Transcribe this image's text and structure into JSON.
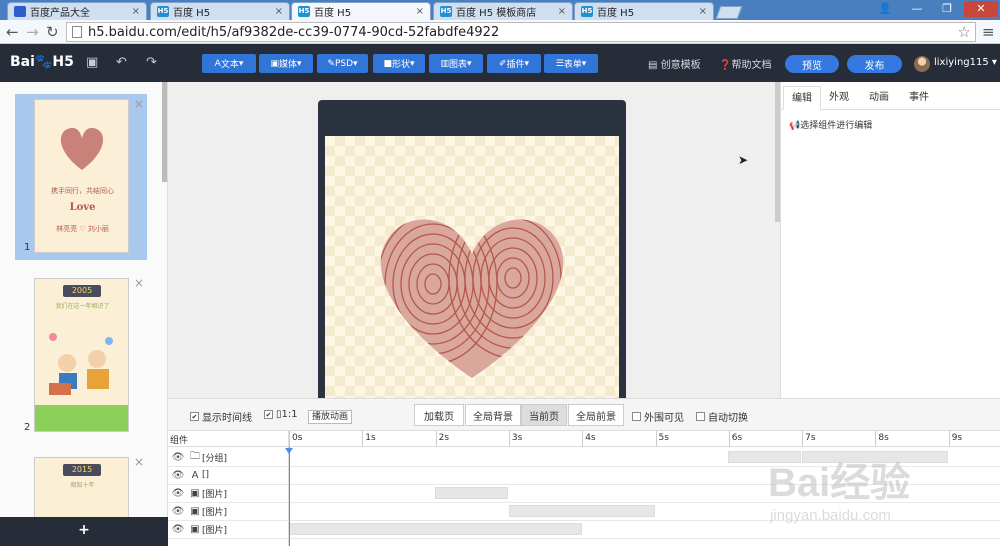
{
  "tabs": [
    {
      "title": "百度产品大全",
      "icon": "baidu-icon",
      "active": false
    },
    {
      "title": "百度 H5",
      "icon": "h5-icon",
      "active": false
    },
    {
      "title": "百度 H5",
      "icon": "h5-icon",
      "active": true
    },
    {
      "title": "百度 H5 模板商店",
      "icon": "h5-icon",
      "active": false
    },
    {
      "title": "百度 H5",
      "icon": "h5-icon",
      "active": false
    }
  ],
  "tab_icon_text": "H5",
  "address": {
    "url": "h5.baidu.com/edit/h5/af9382de-cc39-0774-90cd-52fabdfe4922"
  },
  "app": {
    "logo": "Bai🐾H5",
    "user": "lixiying115"
  },
  "toolbar": {
    "buttons": [
      "文本",
      "媒体",
      "PSD",
      "形状",
      "图表",
      "插件",
      "表单"
    ],
    "links": [
      "创意模板",
      "帮助文档"
    ],
    "preview": "预览",
    "publish": "发布"
  },
  "pages": [
    {
      "num": "1",
      "year": "",
      "lines": [
        "携手同行，共结同心",
        "Love",
        "林亮亮 ♡ 刘小丽"
      ]
    },
    {
      "num": "2",
      "year": "2005",
      "lines": [
        "我们在这一年相识了"
      ]
    },
    {
      "num": "3",
      "year": "2015",
      "lines": [
        "相知十年"
      ]
    }
  ],
  "right_panel": {
    "tabs": [
      "编辑",
      "外观",
      "动画",
      "事件"
    ],
    "hint": "选择组件进行编辑"
  },
  "timeline": {
    "show_timeline": "显示时间线",
    "ratio": "1:1",
    "play": "播放动画",
    "seg": [
      "加载页",
      "全局背景",
      "当前页",
      "全局前景"
    ],
    "outer_visible": "外围可见",
    "auto_switch": "自动切换",
    "col": "组件",
    "ticks": [
      "0s",
      "1s",
      "2s",
      "3s",
      "4s",
      "5s",
      "6s",
      "7s",
      "8s",
      "9s"
    ],
    "layers": [
      "[分组]",
      "[]",
      "[图片]",
      "[图片]",
      "[图片]"
    ],
    "layer_icons": [
      "folder-icon",
      "text-icon",
      "image-icon",
      "image-icon",
      "image-icon"
    ]
  },
  "watermark": {
    "text": "Bai经验",
    "sub": "jingyan.baidu.com"
  },
  "colors": {
    "accent": "#3275d8",
    "dark": "#262c38",
    "heart": "#b5574a"
  }
}
